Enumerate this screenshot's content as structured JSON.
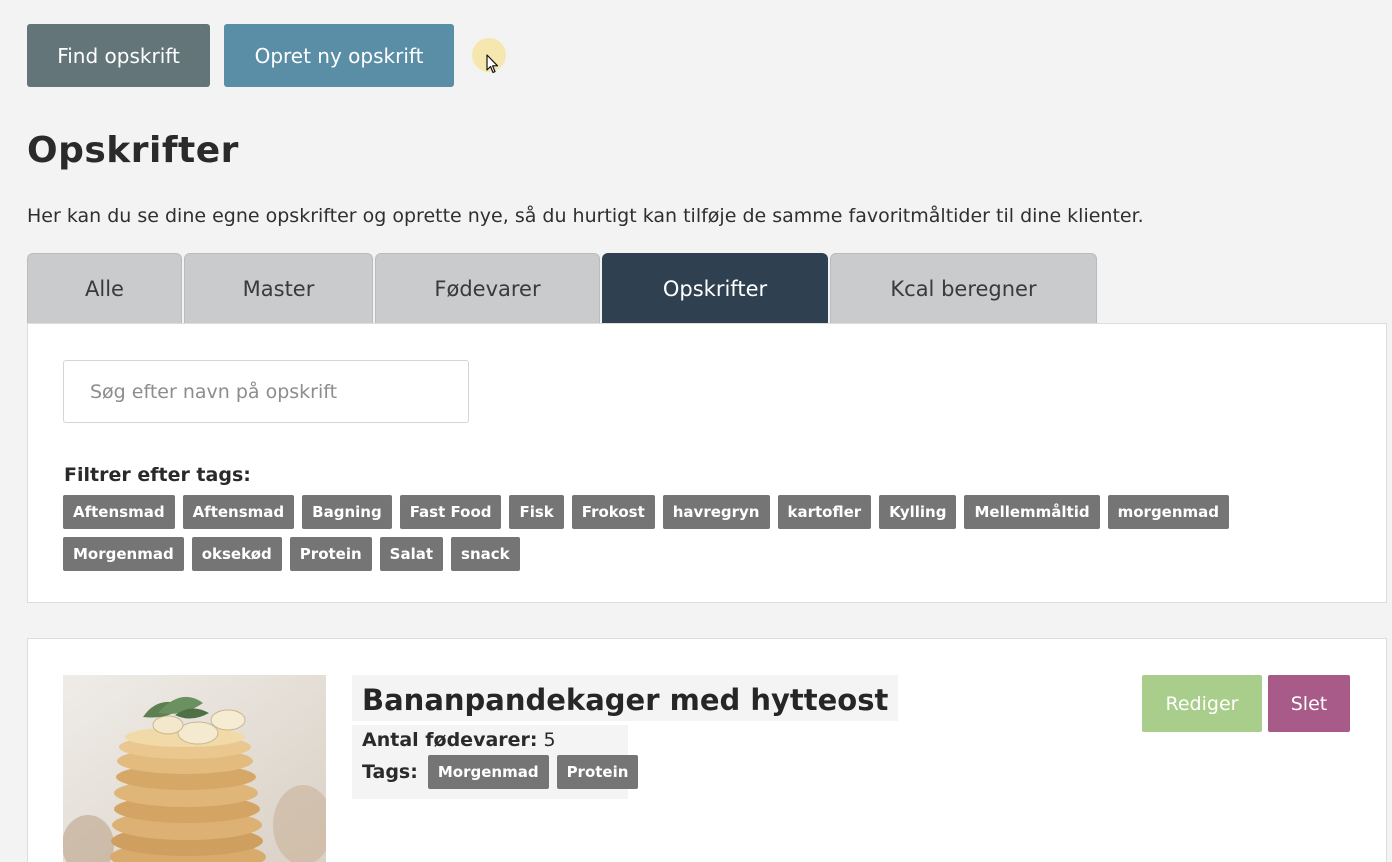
{
  "toolbar": {
    "find_label": "Find opskrift",
    "new_label": "Opret ny opskrift"
  },
  "header": {
    "title": "Opskrifter",
    "description": "Her kan du se dine egne opskrifter og oprette nye, så du hurtigt kan tilføje de samme favoritmåltider til dine klienter."
  },
  "tabs": [
    {
      "label": "Alle",
      "active": false
    },
    {
      "label": "Master",
      "active": false
    },
    {
      "label": "Fødevarer",
      "active": false
    },
    {
      "label": "Opskrifter",
      "active": true
    },
    {
      "label": "Kcal beregner",
      "active": false
    }
  ],
  "filter": {
    "search_placeholder": "Søg efter navn på opskrift",
    "search_value": "",
    "tags_label": "Filtrer efter tags:",
    "tags": [
      "Aftensmad",
      "Aftensmad",
      "Bagning",
      "Fast Food",
      "Fisk",
      "Frokost",
      "havregryn",
      "kartofler",
      "Kylling",
      "Mellemmåltid",
      "morgenmad",
      "Morgenmad",
      "oksekød",
      "Protein",
      "Salat",
      "snack"
    ]
  },
  "recipe": {
    "title": "Bananpandekager med hytteost",
    "ingredients_label": "Antal fødevarer:",
    "ingredients_count": "5",
    "tags_label": "Tags:",
    "tags": [
      "Morgenmad",
      "Protein"
    ],
    "edit_label": "Rediger",
    "delete_label": "Slet",
    "image_alt": "pancake-stack-photo"
  },
  "colors": {
    "find_button": "#637579",
    "new_button": "#5a8ea7",
    "active_tab": "#2f4150",
    "tab": "#c9cbcd",
    "tag": "#757575",
    "edit_button": "#a9cd8a",
    "delete_button": "#a85a88"
  }
}
